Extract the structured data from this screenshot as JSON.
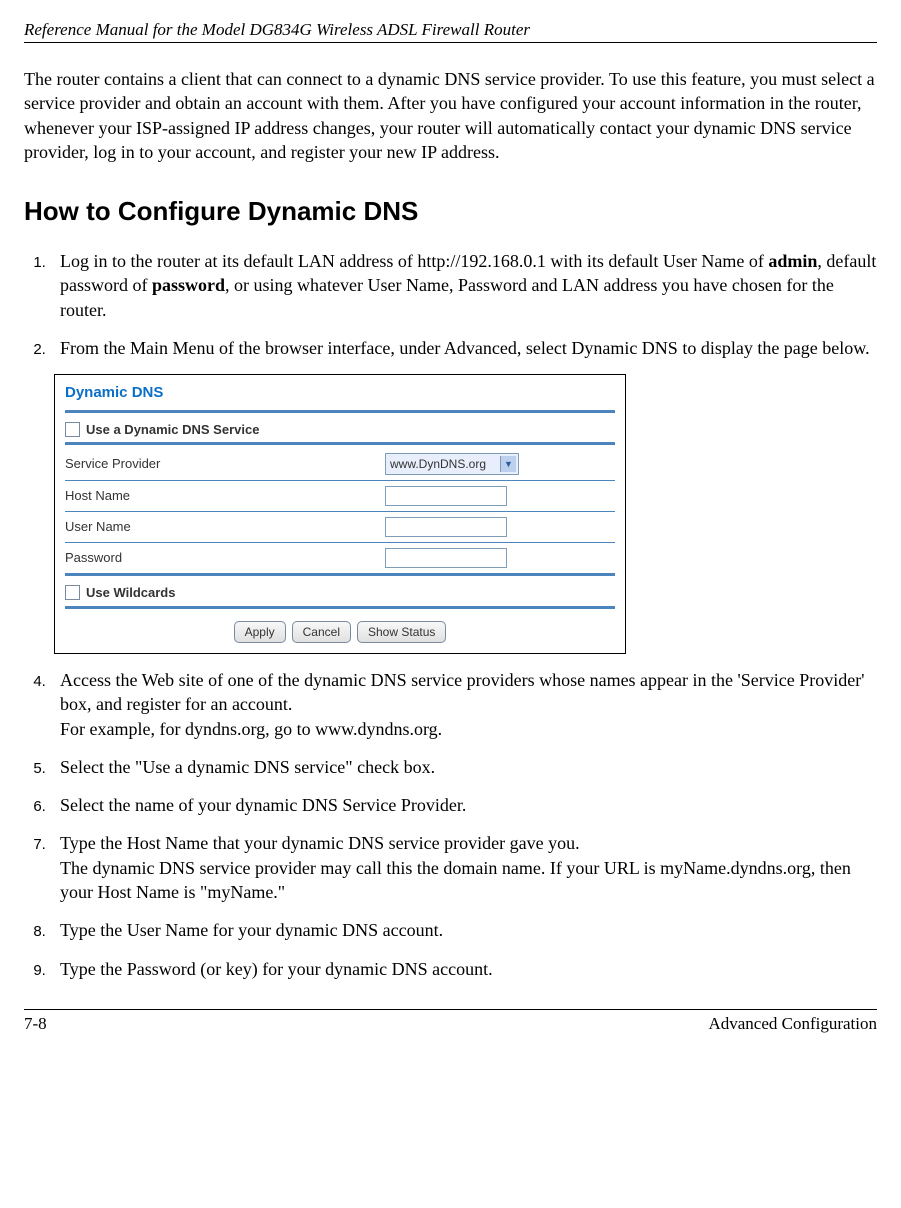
{
  "header": {
    "title": "Reference Manual for the Model DG834G Wireless ADSL Firewall Router"
  },
  "intro": "The router contains a client that can connect to a dynamic DNS service provider. To use this feature, you must select a service provider and obtain an account with them. After you have configured your account information in the router, whenever your ISP-assigned IP address changes, your router will automatically contact your dynamic DNS service provider, log in to your account, and register your new IP address.",
  "heading": "How to Configure Dynamic DNS",
  "steps": {
    "s1_a": "Log in to the router at its default LAN address of http://192.168.0.1 with its default User Name of ",
    "s1_b": "admin",
    "s1_c": ", default password of ",
    "s1_d": "password",
    "s1_e": ", or using whatever User Name, Password and LAN address you have chosen for the router.",
    "s2": "From the Main Menu of the browser interface, under Advanced, select Dynamic DNS to display the page below.",
    "s3": "Access the Web site of one of the dynamic DNS service providers whose names appear in the 'Service Provider' box, and register for an account.\nFor example, for dyndns.org, go to www.dyndns.org.",
    "s4": "Select the \"Use a dynamic DNS service\" check box.",
    "s5": "Select the name of your dynamic DNS Service Provider.",
    "s6": "Type the Host Name that your dynamic DNS service provider gave you.\nThe dynamic DNS service provider may call this the domain name. If your URL is myName.dyndns.org, then your Host Name is \"myName.\"",
    "s7": "Type the User Name for your dynamic DNS account.",
    "s8": "Type the Password (or key) for your dynamic DNS account."
  },
  "screenshot": {
    "title": "Dynamic DNS",
    "use_service": "Use a Dynamic DNS Service",
    "service_provider_label": "Service Provider",
    "service_provider_value": "www.DynDNS.org",
    "host_name": "Host Name",
    "user_name": "User Name",
    "password": "Password",
    "use_wildcards": "Use Wildcards",
    "btn_apply": "Apply",
    "btn_cancel": "Cancel",
    "btn_status": "Show Status"
  },
  "footer": {
    "page": "7-8",
    "section": "Advanced Configuration"
  }
}
